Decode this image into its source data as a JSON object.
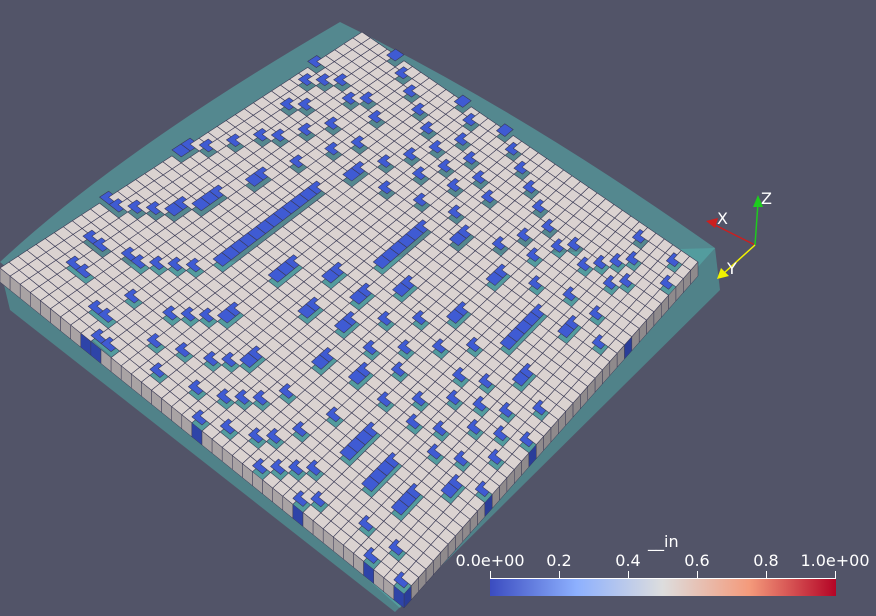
{
  "window": {
    "background_color": "#525468"
  },
  "axes_triad": {
    "x_label": "X",
    "y_label": "Y",
    "z_label": "Z",
    "x_color": "#cc1f1f",
    "y_color": "#f2f200",
    "z_color": "#1ecc1e"
  },
  "scalar_bar": {
    "title": "__in",
    "ticks": [
      "0.0e+00",
      "0.2",
      "0.4",
      "0.6",
      "0.8",
      "1.0e+00"
    ],
    "range": [
      0,
      1
    ],
    "colormap": {
      "low": "#3b4cc0",
      "mid": "#dddddd",
      "high": "#b40426"
    }
  },
  "mesh": {
    "solid_color": "#dbd3d1",
    "inclusion_color": "#3f5bd3",
    "outline_color": "#4fa7a4",
    "grid_lines": "#3a3a55"
  }
}
